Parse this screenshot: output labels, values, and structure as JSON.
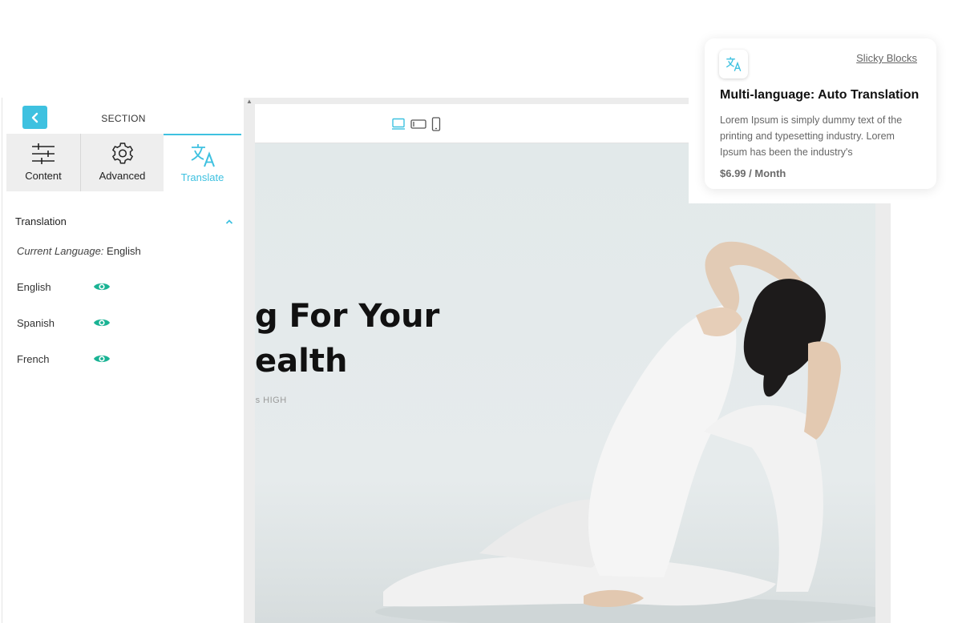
{
  "panel": {
    "title": "SECTION",
    "tabs": [
      {
        "label": "Content",
        "icon": "sliders-icon"
      },
      {
        "label": "Advanced",
        "icon": "gear-icon"
      },
      {
        "label": "Translate",
        "icon": "translate-icon"
      }
    ],
    "section_label": "Translation",
    "current_language_prefix": "Current Language:",
    "current_language_value": "English",
    "languages": [
      {
        "name": "English",
        "visible": true
      },
      {
        "name": "Spanish",
        "visible": true
      },
      {
        "name": "French",
        "visible": true
      }
    ]
  },
  "preview": {
    "hero_line1": "g For Your",
    "hero_line2": "ealth",
    "hero_sub": "'s HIGH",
    "devices": [
      "desktop-icon",
      "tablet-icon",
      "mobile-icon"
    ]
  },
  "card": {
    "brand": "Slicky Blocks",
    "title": "Multi-language: Auto Translation",
    "description": "Lorem Ipsum is simply dummy text of the printing and typesetting industry. Lorem Ipsum has been the industry's",
    "price": "$6.99 / Month"
  },
  "colors": {
    "accent": "#3ec1e0",
    "eye": "#1ab394"
  }
}
